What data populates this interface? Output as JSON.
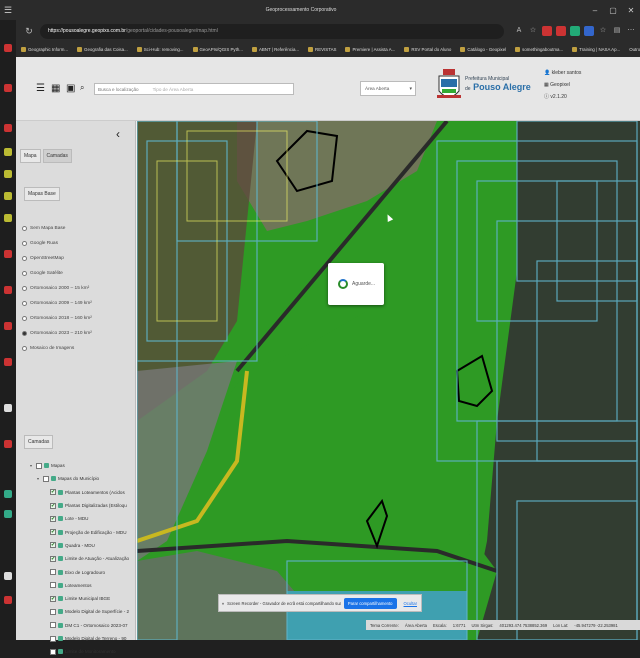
{
  "window": {
    "title": "Geoprocessamento Corporativo",
    "menu_icon": "menu-icon"
  },
  "address": {
    "url_host": "https://pousoalegre.geopixs.com.br",
    "url_path": "/geoportal/cidades-pousoalegre/map.html"
  },
  "bookmarks": [
    {
      "label": "Geographic Inform..."
    },
    {
      "label": "Geografia das Coisa..."
    },
    {
      "label": "Sci-Hub: removing..."
    },
    {
      "label": "GeoAPIs/QGIS Pyth..."
    },
    {
      "label": "ABNT | Referência..."
    },
    {
      "label": "REVISTAS"
    },
    {
      "label": "Premiere | Assista A..."
    },
    {
      "label": "RSV Portal do Aluno"
    },
    {
      "label": "Catálogo - Geopixel"
    },
    {
      "label": "somethingaboutma..."
    },
    {
      "label": "Training | NASA Ap..."
    }
  ],
  "bookmarks_more": "Outros favoritos",
  "header": {
    "search_placeholder": "Busca e localização",
    "search_placeholder2": "Tipo de Área Aberta",
    "area_select": "Área Aberta",
    "pref_label": "Prefeitura Municipal",
    "pref_de": "de",
    "city": "Pouso Alegre",
    "user": "kleber santos",
    "org": "Geopixel",
    "version": "v2.1.20"
  },
  "panel": {
    "collapse": "‹",
    "tabs": [
      "Mapa",
      "Camadas"
    ],
    "basemap_label": "Mapas Base",
    "basemaps": [
      {
        "label": "Sem Mapa Base",
        "selected": false
      },
      {
        "label": "Google Ruas",
        "selected": false
      },
      {
        "label": "OpenStreetMap",
        "selected": false
      },
      {
        "label": "Google Satélite",
        "selected": false
      },
      {
        "label": "Ortomosaico 2000 – 15 km²",
        "selected": false
      },
      {
        "label": "Ortomosaico 2009 – 149 km²",
        "selected": false
      },
      {
        "label": "Ortomosaico 2018 – 160 km²",
        "selected": false
      },
      {
        "label": "Ortomosaico 2023 – 210 km²",
        "selected": true
      },
      {
        "label": "Mosaico de Imagens",
        "selected": false
      }
    ],
    "layers_label": "Camadas",
    "layers": [
      {
        "label": "Mapas",
        "checked": false,
        "folder": true,
        "level": 0
      },
      {
        "label": "Mapas do Município",
        "checked": false,
        "folder": true,
        "level": 1
      },
      {
        "label": "Plantas Loteamentos (Acidos",
        "checked": true,
        "folder": false,
        "level": 2
      },
      {
        "label": "Plantas Digitalizadas (Estiloqu",
        "checked": true,
        "folder": false,
        "level": 2
      },
      {
        "label": "Lote - MDU",
        "checked": true,
        "folder": false,
        "level": 2
      },
      {
        "label": "Projeção de Edificação - MDU",
        "checked": true,
        "folder": false,
        "level": 2
      },
      {
        "label": "Quadra - MDU",
        "checked": true,
        "folder": false,
        "level": 2
      },
      {
        "label": "Limite de Atuação - Atualização",
        "checked": true,
        "folder": false,
        "level": 2
      },
      {
        "label": "Eixo de Logradouro",
        "checked": false,
        "folder": false,
        "level": 2
      },
      {
        "label": "Loteamentos",
        "checked": false,
        "folder": false,
        "level": 2
      },
      {
        "label": "Limite Municipal IBGE",
        "checked": true,
        "folder": false,
        "level": 2
      },
      {
        "label": "Modelo Digital de Superfície - 2",
        "checked": false,
        "folder": false,
        "level": 2
      },
      {
        "label": "DM C1 - Ortomosaico 2023-07",
        "checked": false,
        "folder": false,
        "level": 2
      },
      {
        "label": "Modelo Digital de Terreno - 90",
        "checked": false,
        "folder": false,
        "level": 2
      },
      {
        "label": "Limite de Monitoramento",
        "checked": false,
        "folder": false,
        "level": 2
      }
    ]
  },
  "modal": {
    "text": "Aguarde..."
  },
  "status": {
    "coord": "Tema Corrente:",
    "area": "Área Aberta",
    "scale_label": "Escala:",
    "scale": "1:6771",
    "utm_label": "Utm Sirgas:",
    "utm": "401293.474 7538852.369",
    "latlon_label": "Lon Lat:",
    "latlon": "-45.947279 -22.253981"
  },
  "recorder": {
    "msg": "Screen Recorder - Gravador de ecrã está compartilhando sua tela.",
    "stop": "Parar compartilhamento",
    "hide": "Ocultar"
  },
  "toolbar": [
    "🔍",
    "⬤",
    "⤢",
    "✥",
    "🔍",
    "🔍",
    "🔍",
    "🔍",
    "🔍",
    "🔍",
    "👤",
    "╱",
    "▭",
    "⬤",
    "⬤",
    "▣",
    "🗎",
    "▤"
  ],
  "colors": {
    "accent": "#1a73e8",
    "grass": "#2e9a24",
    "parcel": "#5fb3c9"
  }
}
